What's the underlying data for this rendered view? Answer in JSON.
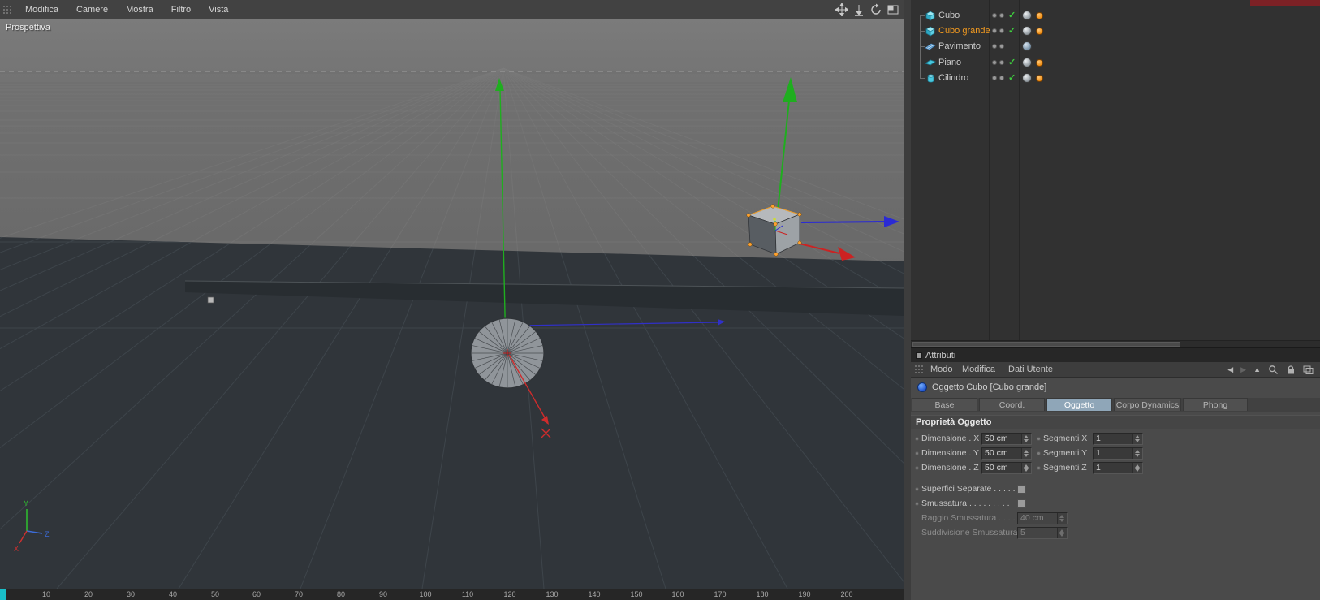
{
  "colors": {
    "selection_orange": "#F49B20",
    "icon_cyan": "#49C8DE",
    "axis_green": "#1FAE1F",
    "axis_red": "#CF2C2C",
    "axis_blue": "#3030C8",
    "active_tab_blue": "#8FA6B8"
  },
  "menubar": {
    "menus": [
      {
        "label": "Modifica"
      },
      {
        "label": "Camere"
      },
      {
        "label": "Mostra"
      },
      {
        "label": "Filtro"
      },
      {
        "label": "Vista"
      }
    ]
  },
  "viewport": {
    "label": "Prospettiva",
    "axis_labels": {
      "x": "X",
      "y": "Y",
      "z": "Z"
    }
  },
  "ruler": {
    "ticks": [
      "10",
      "20",
      "30",
      "40",
      "50",
      "60",
      "70",
      "80",
      "90",
      "100",
      "110",
      "120",
      "130",
      "140",
      "150",
      "160",
      "170",
      "180",
      "190",
      "200"
    ]
  },
  "object_manager": {
    "items": [
      {
        "label": "Cubo",
        "type": "cube",
        "selected": false,
        "enabled_check": true,
        "has_material": true,
        "has_texture_tag": true
      },
      {
        "label": "Cubo grande",
        "type": "cube",
        "selected": true,
        "enabled_check": true,
        "has_material": true,
        "has_texture_tag": true
      },
      {
        "label": "Pavimento",
        "type": "floor",
        "selected": false,
        "enabled_check": false,
        "has_material": true,
        "has_texture_tag": false
      },
      {
        "label": "Piano",
        "type": "plane",
        "selected": false,
        "enabled_check": true,
        "has_material": true,
        "has_texture_tag": true
      },
      {
        "label": "Cilindro",
        "type": "cylinder",
        "selected": false,
        "enabled_check": true,
        "has_material": true,
        "has_texture_tag": true
      }
    ]
  },
  "attributes": {
    "panel_title": "Attributi",
    "mode_tabs": [
      {
        "label": "Modo"
      },
      {
        "label": "Modifica"
      },
      {
        "label": "Dati Utente"
      }
    ],
    "object_title": "Oggetto Cubo [Cubo grande]",
    "tabs": [
      {
        "label": "Base",
        "active": false
      },
      {
        "label": "Coord.",
        "active": false
      },
      {
        "label": "Oggetto",
        "active": true
      },
      {
        "label": "Corpo Dynamics",
        "active": false
      },
      {
        "label": "Phong",
        "active": false
      }
    ],
    "section_title": "Proprietà Oggetto",
    "params": {
      "dim_x": {
        "label": "Dimensione . X",
        "value": "50 cm"
      },
      "dim_y": {
        "label": "Dimensione . Y",
        "value": "50 cm"
      },
      "dim_z": {
        "label": "Dimensione . Z",
        "value": "50 cm"
      },
      "seg_x": {
        "label": "Segmenti X",
        "value": "1"
      },
      "seg_y": {
        "label": "Segmenti Y",
        "value": "1"
      },
      "seg_z": {
        "label": "Segmenti Z",
        "value": "1"
      },
      "superfici": {
        "label": "Superfici Separate . . . . .",
        "checked": false
      },
      "smussatura": {
        "label": "Smussatura . . . . . . . . .",
        "checked": false
      },
      "raggio": {
        "label": "Raggio Smussatura . . . .",
        "value": "40 cm",
        "disabled": true
      },
      "suddivisione": {
        "label": "Suddivisione Smussatura",
        "value": "5",
        "disabled": true
      }
    }
  }
}
